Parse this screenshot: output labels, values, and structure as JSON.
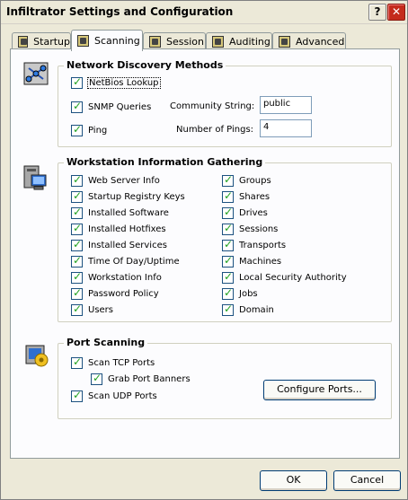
{
  "window": {
    "title": "Infiltrator Settings and Configuration",
    "help_label": "?",
    "close_label": "✕"
  },
  "tabs": [
    {
      "label": "Startup",
      "active": false
    },
    {
      "label": "Scanning",
      "active": true
    },
    {
      "label": "Session",
      "active": false
    },
    {
      "label": "Auditing",
      "active": false
    },
    {
      "label": "Advanced",
      "active": false
    }
  ],
  "network": {
    "title": "Network Discovery Methods",
    "netbios": {
      "label": "NetBios Lookup",
      "checked": true
    },
    "snmp": {
      "label": "SNMP Queries",
      "checked": true
    },
    "ping": {
      "label": "Ping",
      "checked": true
    },
    "community_label": "Community String:",
    "community_value": "public",
    "pings_label": "Number of Pings:",
    "pings_value": "4"
  },
  "workstation": {
    "title": "Workstation Information Gathering",
    "left": [
      {
        "label": "Web Server Info",
        "checked": true
      },
      {
        "label": "Startup Registry Keys",
        "checked": true
      },
      {
        "label": "Installed Software",
        "checked": true
      },
      {
        "label": "Installed Hotfixes",
        "checked": true
      },
      {
        "label": "Installed Services",
        "checked": true
      },
      {
        "label": "Time Of Day/Uptime",
        "checked": true
      },
      {
        "label": "Workstation Info",
        "checked": true
      },
      {
        "label": "Password Policy",
        "checked": true
      },
      {
        "label": "Users",
        "checked": true
      }
    ],
    "right": [
      {
        "label": "Groups",
        "checked": true
      },
      {
        "label": "Shares",
        "checked": true
      },
      {
        "label": "Drives",
        "checked": true
      },
      {
        "label": "Sessions",
        "checked": true
      },
      {
        "label": "Transports",
        "checked": true
      },
      {
        "label": "Machines",
        "checked": true
      },
      {
        "label": "Local Security Authority",
        "checked": true
      },
      {
        "label": "Jobs",
        "checked": true
      },
      {
        "label": "Domain",
        "checked": true
      }
    ]
  },
  "ports": {
    "title": "Port Scanning",
    "tcp": {
      "label": "Scan TCP Ports",
      "checked": true
    },
    "banners": {
      "label": "Grab Port Banners",
      "checked": true
    },
    "udp": {
      "label": "Scan UDP Ports",
      "checked": true
    },
    "configure_label": "Configure Ports..."
  },
  "footer": {
    "ok_label": "OK",
    "cancel_label": "Cancel"
  },
  "icons": {
    "tab_icon": "tab-page-icon",
    "network_icon": "network-discovery-icon",
    "workstation_icon": "workstation-icon",
    "ports_icon": "port-scanning-icon"
  }
}
